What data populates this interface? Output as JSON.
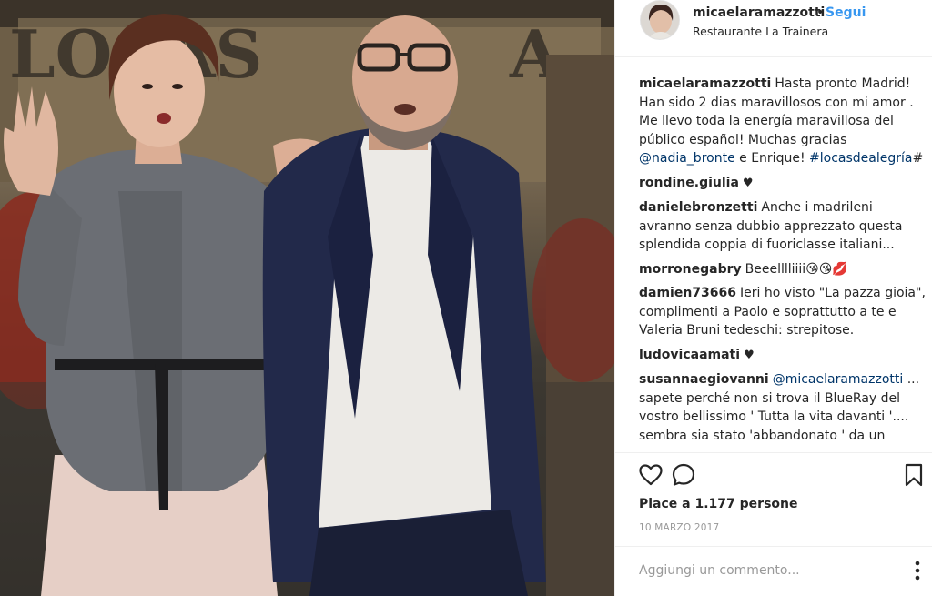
{
  "post": {
    "photo_alt": "",
    "header": {
      "username": "micaelaramazzotti",
      "separator": "•",
      "follow_label": "Segui",
      "location": "Restaurante La Trainera"
    },
    "caption": {
      "username": "micaelaramazzotti",
      "text_part1": "Hasta pronto Madrid! Han sido 2 dias maravillosos con mi amor . Me llevo toda la energía maravillosa del público español! Muchas gracias ",
      "mention": "@nadia_bronte",
      "text_part2": " e Enrique! ",
      "hashtag": "#locasdealegría",
      "text_part3": "#"
    },
    "comments": [
      {
        "username": "rondine.giulia",
        "text": "♥"
      },
      {
        "username": "danielebronzetti",
        "text": "Anche i madrileni avranno senza dubbio apprezzato questa splendida coppia di fuoriclasse italiani..."
      },
      {
        "username": "morronegabry",
        "text": "Beeelllliiii😘😘💋"
      },
      {
        "username": "damien73666",
        "text": "Ieri ho visto \"La pazza gioia\", complimenti a Paolo e soprattutto a te e Valeria Bruni tedeschi: strepitose."
      },
      {
        "username": "ludovicaamati",
        "text": "♥"
      },
      {
        "username": "susannaegiovanni",
        "mention": "@micaelaramazzotti",
        "text": " ... sapete perché non si trova il BlueRay del vostro bellissimo ' Tutta la vita davanti '.... sembra sia stato 'abbandonato ' da un"
      }
    ],
    "likes": {
      "prefix": "Piace a ",
      "count": "1.177 persone"
    },
    "date": "10 MARZO 2017",
    "comment_input": {
      "placeholder": "Aggiungi un commento..."
    },
    "icons": {
      "like": "heart-outline-icon",
      "comment": "speech-bubble-icon",
      "save": "bookmark-icon",
      "more": "more-dots-icon"
    },
    "colors": {
      "link": "#3897f0",
      "mention": "#003569",
      "text": "#262626",
      "muted": "#999999",
      "border": "#efefef"
    }
  }
}
